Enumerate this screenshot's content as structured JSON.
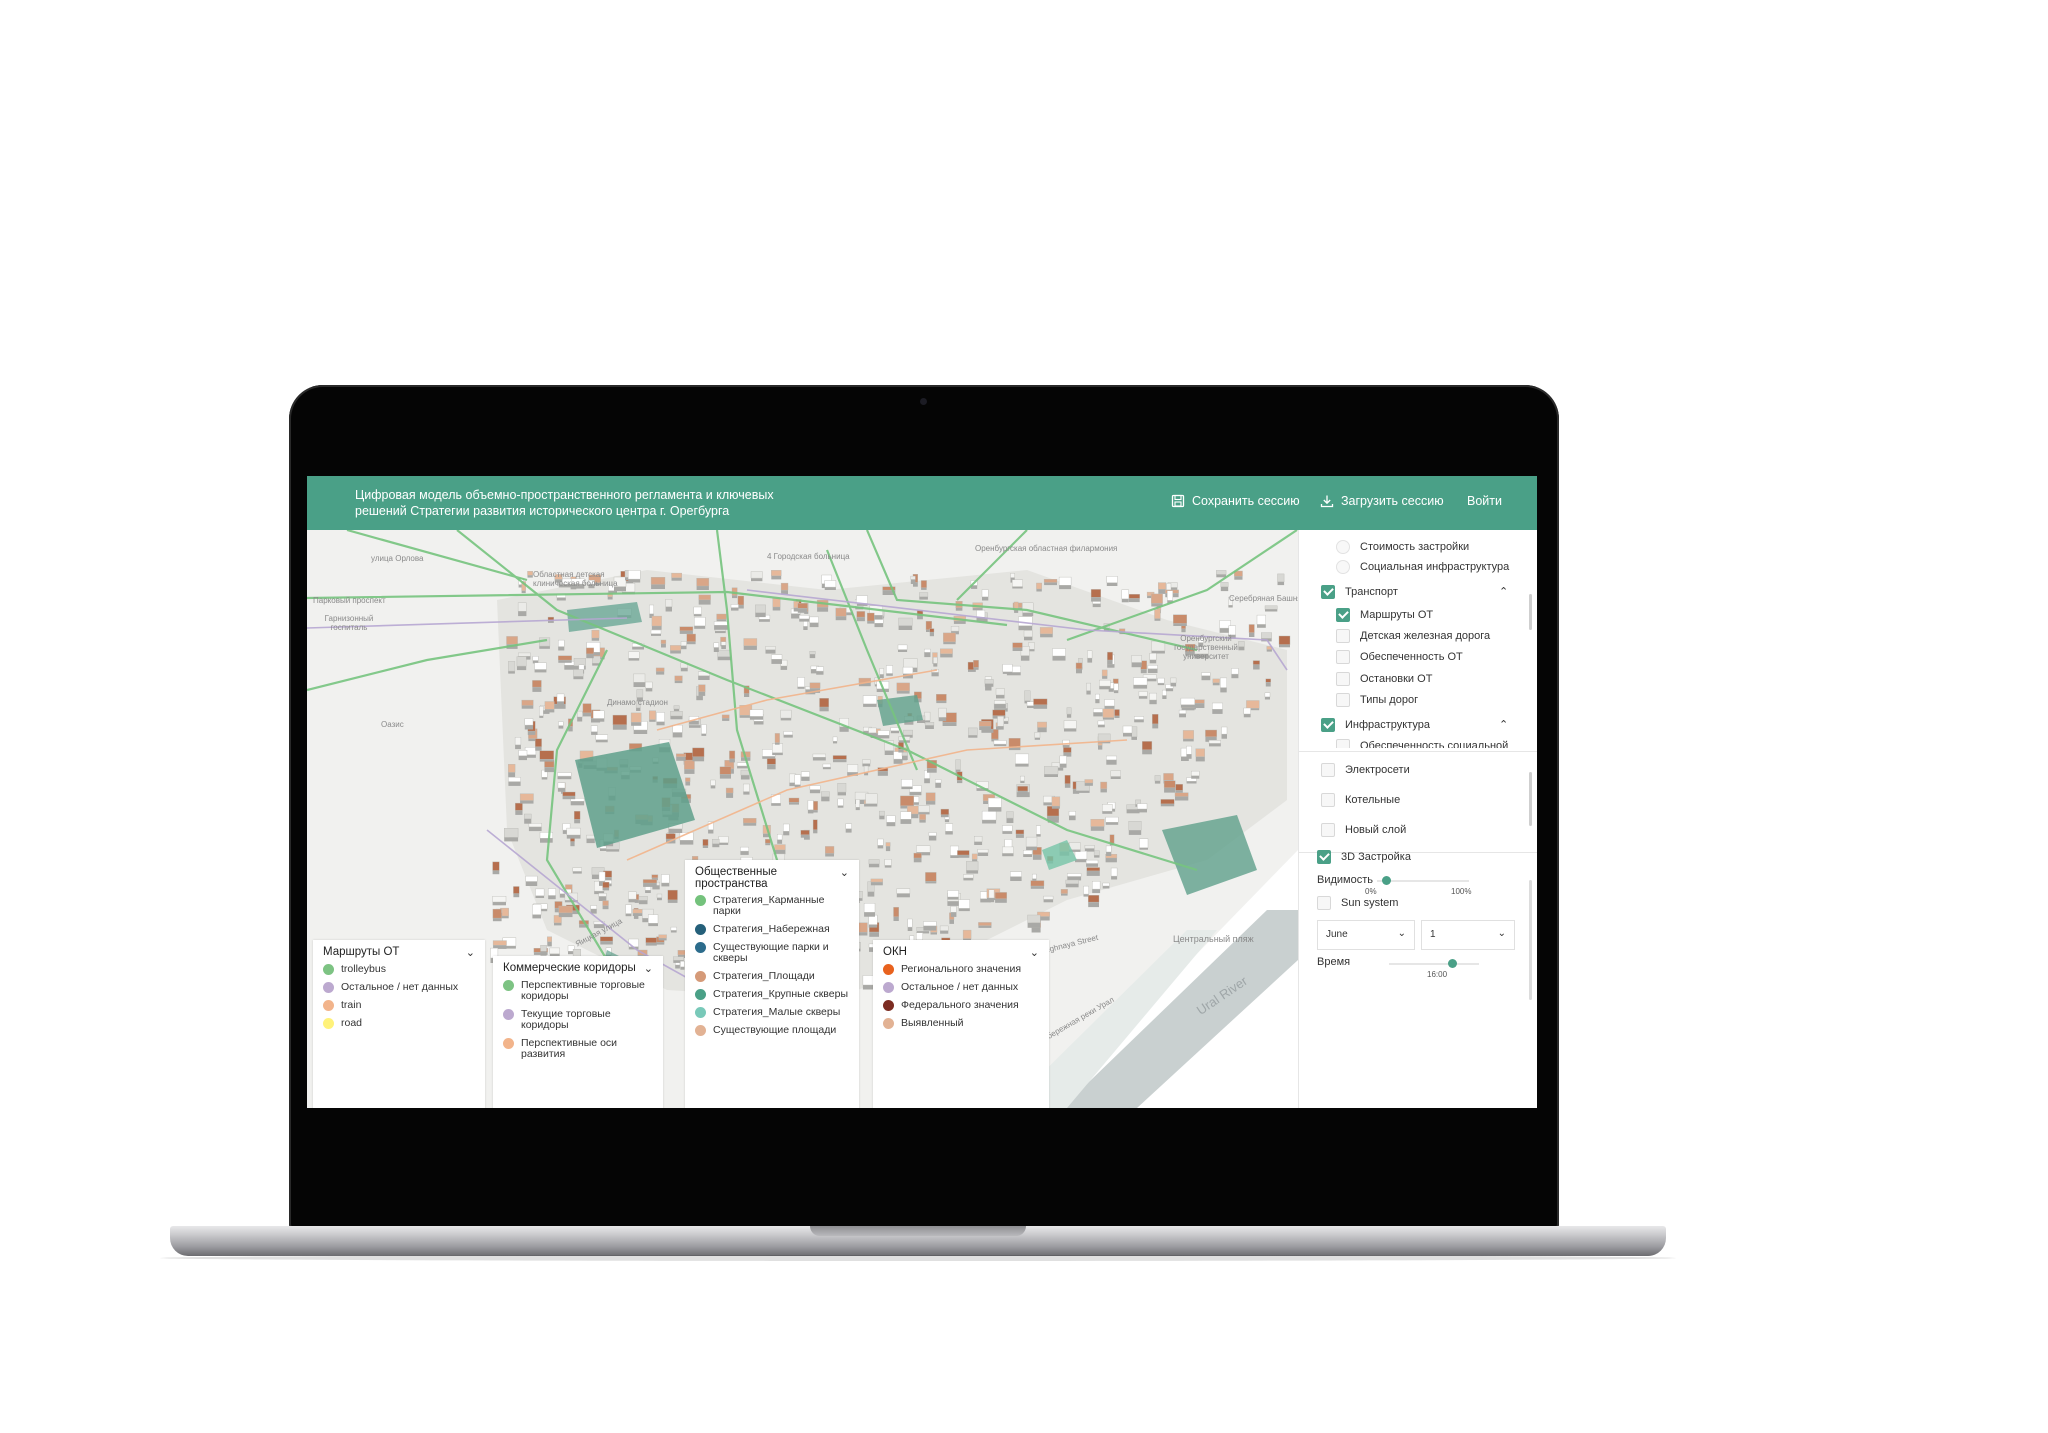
{
  "app": {
    "title": "Цифровая модель объемно-пространственного регламента и ключевых решений Стратегии развития исторического центра г. Орегбурга",
    "accent_color": "#4aa087",
    "actions": {
      "save_session": "Сохранить сессию",
      "load_session": "Загрузить сессию",
      "login": "Войти"
    }
  },
  "map_labels": {
    "orenburg_philharmonic": "Оренбургская областная филармония",
    "state_university": "Оренбургский государственный университет",
    "childrens_hospital": "Областная детская клиническая больница",
    "dinamo": "Динамо стадион",
    "garrison": "Гарнизонный госпиталь",
    "park": "Парковый проспект",
    "central_beach": "Центральный пляж",
    "ural_river": "Ural River",
    "embankment": "Набережная реки Урал",
    "nabereghnaya": "Nabereghnaya Street",
    "yaitsk": "Яицкая улица",
    "oasis": "Оазис",
    "silver_tower": "Серебряная Башня",
    "orlov_street": "улица Орлова",
    "hospital_4": "4 Городская больница"
  },
  "legends": {
    "routes": {
      "title": "Маршруты ОТ",
      "items": [
        {
          "label": "trolleybus",
          "color": "#7dc383"
        },
        {
          "label": "Остальное / нет данных",
          "color": "#bca9cf"
        },
        {
          "label": "train",
          "color": "#f2b48b"
        },
        {
          "label": "road",
          "color": "#fff27a"
        }
      ]
    },
    "commercial": {
      "title": "Коммерческие коридоры",
      "items": [
        {
          "label": "Перспективные торговые коридоры",
          "color": "#7dc383"
        },
        {
          "label": "Текущие торговые коридоры",
          "color": "#bca9cf"
        },
        {
          "label": "Перспективные оси развития",
          "color": "#f2b48b"
        }
      ]
    },
    "public_spaces": {
      "title": "Общественные пространства",
      "items": [
        {
          "label": "Стратегия_Карманные парки",
          "color": "#74c27c"
        },
        {
          "label": "Стратегия_Набережная",
          "color": "#25607a"
        },
        {
          "label": "Существующие парки и скверы",
          "color": "#2c6c8c"
        },
        {
          "label": "Стратегия_Площади",
          "color": "#d59a78"
        },
        {
          "label": "Стратегия_Крупные скверы",
          "color": "#4aa087"
        },
        {
          "label": "Стратегия_Малые скверы",
          "color": "#79c9b9"
        },
        {
          "label": "Существующие площади",
          "color": "#e2b294"
        }
      ]
    },
    "okn": {
      "title": "ОКН",
      "items": [
        {
          "label": "Регионального значения",
          "color": "#e8621e"
        },
        {
          "label": "Остальное / нет данных",
          "color": "#bca9cf"
        },
        {
          "label": "Федерального значения",
          "color": "#7c2c22"
        },
        {
          "label": "Выявленный",
          "color": "#e2b294"
        }
      ]
    }
  },
  "panel": {
    "layers_top": [
      {
        "label": "Стоимость застройки",
        "checked": false
      },
      {
        "label": "Социальная инфраструктура",
        "checked": false
      }
    ],
    "transport": {
      "label": "Транспорт",
      "checked": true,
      "children": [
        {
          "label": "Маршруты ОТ",
          "checked": true
        },
        {
          "label": "Детская железная дорога",
          "checked": false
        },
        {
          "label": "Обеспеченность ОТ",
          "checked": false
        },
        {
          "label": "Остановки ОТ",
          "checked": false
        },
        {
          "label": "Типы дорог",
          "checked": false
        }
      ]
    },
    "infrastructure": {
      "label": "Инфраструктура",
      "checked": true,
      "partial_child": "Обеспеченность социальной"
    },
    "extra_layers": [
      {
        "label": "Электросети",
        "checked": false
      },
      {
        "label": "Котельные",
        "checked": false
      },
      {
        "label": "Новый слой",
        "checked": false
      }
    ],
    "buildings_3d": {
      "label": "3D Застройка",
      "checked": true
    },
    "visibility": {
      "label": "Видимость",
      "min_label": "0%",
      "max_label": "100%",
      "value": 0.1
    },
    "sun_system": {
      "label": "Sun system",
      "checked": false
    },
    "month_select": "June",
    "day_select": "1",
    "time": {
      "label": "Время",
      "value_label": "16:00",
      "value": 0.7
    }
  }
}
